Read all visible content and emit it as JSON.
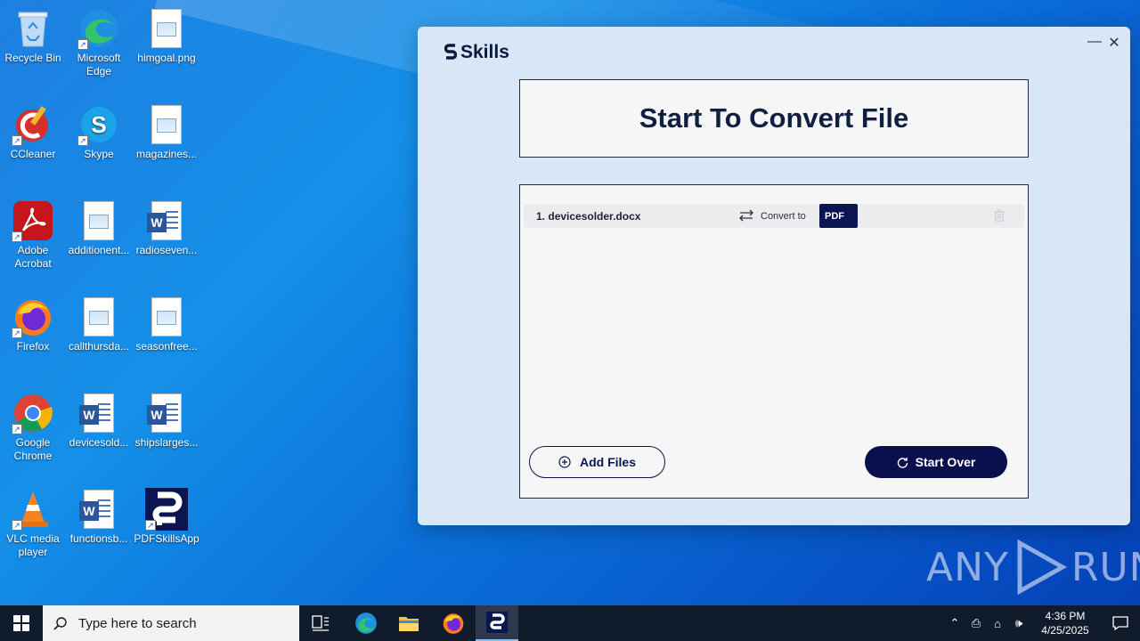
{
  "desktop": {
    "icons": [
      {
        "label": "Recycle Bin"
      },
      {
        "label": "Microsoft Edge"
      },
      {
        "label": "himgoal.png"
      },
      {
        "label": "CCleaner"
      },
      {
        "label": "Skype"
      },
      {
        "label": "magazines..."
      },
      {
        "label": "Adobe Acrobat"
      },
      {
        "label": "additionent..."
      },
      {
        "label": "radioseven..."
      },
      {
        "label": "Firefox"
      },
      {
        "label": "callthursda..."
      },
      {
        "label": "seasonfree..."
      },
      {
        "label": "Google Chrome"
      },
      {
        "label": "devicesold..."
      },
      {
        "label": "shipslarges..."
      },
      {
        "label": "VLC media player"
      },
      {
        "label": "functionsb..."
      },
      {
        "label": "PDFSkillsApp"
      }
    ]
  },
  "app": {
    "logo_text": "Skills",
    "minimize_glyph": "—",
    "close_glyph": "✕",
    "title": "Start To Convert File",
    "files": [
      {
        "index": "1.",
        "name": "devicesolder.docx",
        "convert_label": "Convert to",
        "format": "PDF"
      }
    ],
    "add_files_label": "Add Files",
    "start_over_label": "Start Over"
  },
  "watermark": {
    "left": "ANY",
    "right": "RUN"
  },
  "taskbar": {
    "search_placeholder": "Type here to search",
    "time": "4:36 PM",
    "date": "4/25/2025"
  },
  "colors": {
    "app_background": "#d9e6f6",
    "primary_navy": "#0a0f4e",
    "taskbar": "#101c2c"
  }
}
